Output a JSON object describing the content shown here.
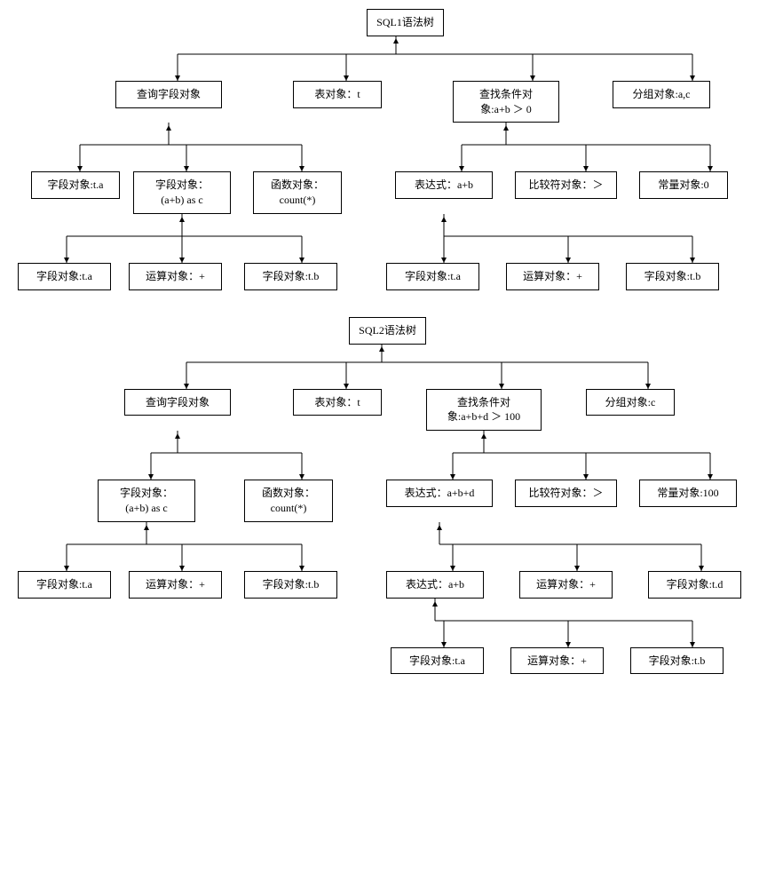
{
  "tree1": {
    "root": "SQL1语法树",
    "l1": {
      "queryField": "查询字段对象",
      "tableObj": "表对象：t",
      "condObj": "查找条件对\n象:a+b ＞ 0",
      "groupObj": "分组对象:a,c"
    },
    "l2": {
      "fieldTa": "字段对象:t.a",
      "fieldAbAsC": "字段对象：\n(a+b) as c",
      "funcCount": "函数对象：\ncount(*)",
      "exprAb": "表达式：a+b",
      "compGt": "比较符对象：＞",
      "const0": "常量对象:0"
    },
    "l3": {
      "fieldTa": "字段对象:t.a",
      "opPlus": "运算对象：+",
      "fieldTb": "字段对象:t.b",
      "fieldTa2": "字段对象:t.a",
      "opPlus2": "运算对象：+",
      "fieldTb2": "字段对象:t.b"
    }
  },
  "tree2": {
    "root": "SQL2语法树",
    "l1": {
      "queryField": "查询字段对象",
      "tableObj": "表对象：t",
      "condObj": "查找条件对\n象:a+b+d ＞ 100",
      "groupObj": "分组对象:c"
    },
    "l2": {
      "fieldAbAsC": "字段对象：\n(a+b) as c",
      "funcCount": "函数对象：\ncount(*)",
      "exprAbd": "表达式：a+b+d",
      "compGt": "比较符对象：＞",
      "const100": "常量对象:100"
    },
    "l3": {
      "fieldTa": "字段对象:t.a",
      "opPlus": "运算对象：+",
      "fieldTb": "字段对象:t.b",
      "exprAb": "表达式：a+b",
      "opPlus2": "运算对象：+",
      "fieldTd": "字段对象:t.d"
    },
    "l4": {
      "fieldTa": "字段对象:t.a",
      "opPlus": "运算对象：+",
      "fieldTb": "字段对象:t.b"
    }
  }
}
